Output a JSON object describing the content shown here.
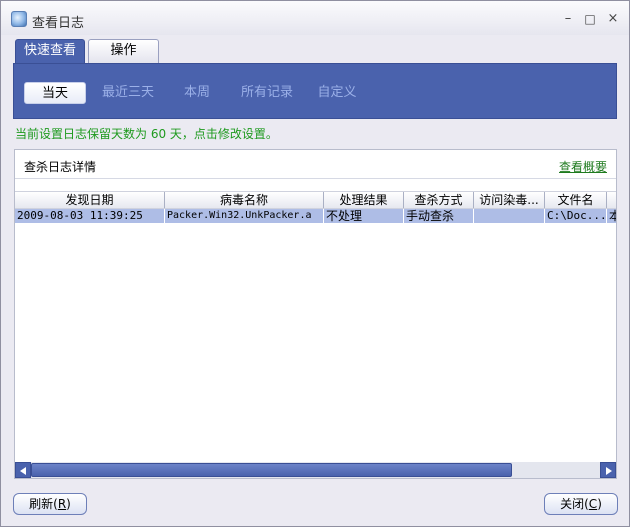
{
  "window": {
    "title": "查看日志",
    "minimize": "–",
    "maximize": "□",
    "close": "×"
  },
  "tabs": [
    {
      "label": "快速查看",
      "active": true
    },
    {
      "label": "操作",
      "active": false
    }
  ],
  "filters": [
    {
      "label": "当天",
      "active": true
    },
    {
      "label": "最近三天",
      "active": false
    },
    {
      "label": "本周",
      "active": false
    },
    {
      "label": "所有记录",
      "active": false
    },
    {
      "label": "自定义",
      "active": false
    }
  ],
  "notice": "当前设置日志保留天数为 60 天，点击修改设置。",
  "panel": {
    "title": "查杀日志详情",
    "link": "查看概要"
  },
  "table": {
    "columns": [
      "发现日期",
      "病毒名称",
      "处理结果",
      "查杀方式",
      "访问染毒...",
      "文件名",
      ""
    ],
    "rows": [
      [
        "2009-08-03 11:39:25",
        "Packer.Win32.UnkPacker.a",
        "不处理",
        "手动查杀",
        "",
        "C:\\Doc...",
        "本"
      ]
    ]
  },
  "buttons": {
    "refresh_text": "刷新(",
    "refresh_key": "R",
    "refresh_end": ")",
    "close_text": "关闭(",
    "close_key": "C",
    "close_end": ")"
  },
  "colors": {
    "accent": "#4a62ad",
    "selected_row": "#aebde6",
    "notice_text": "#1e9a1e"
  }
}
